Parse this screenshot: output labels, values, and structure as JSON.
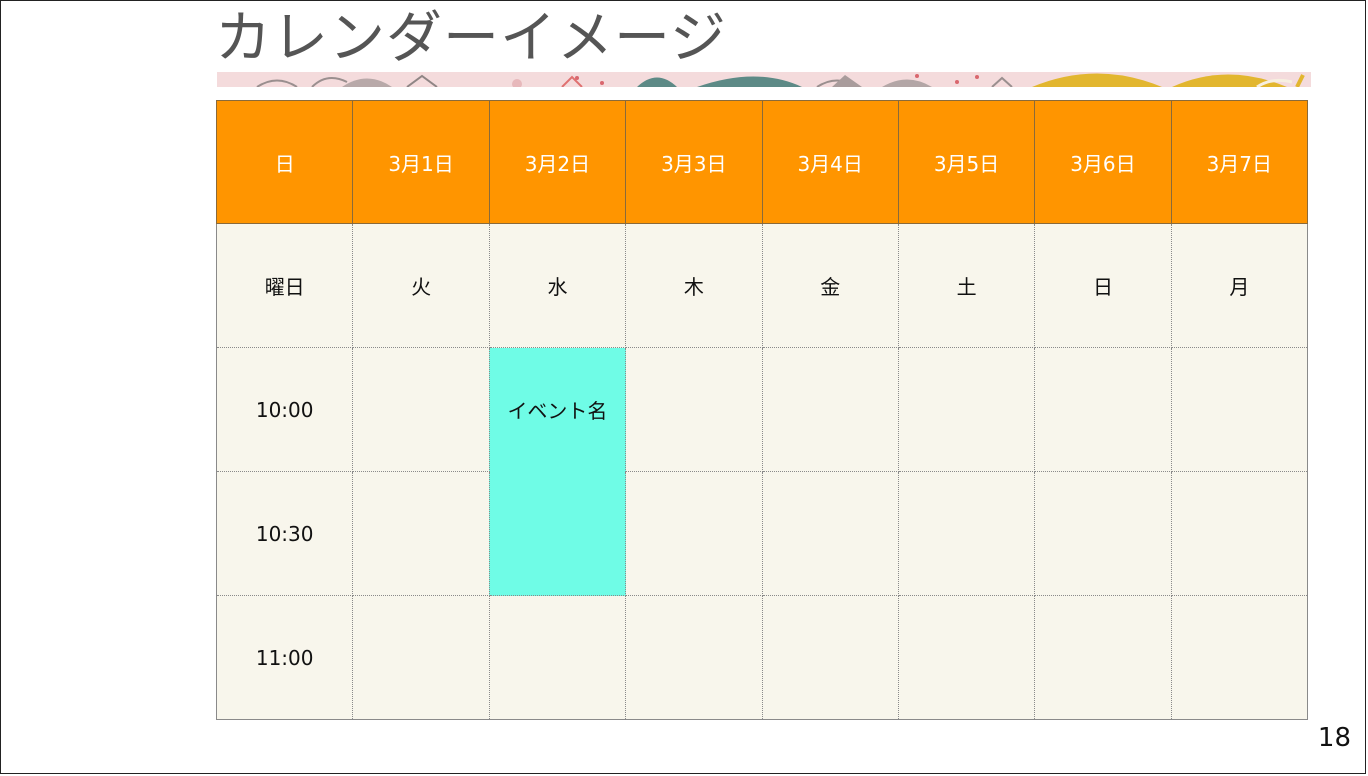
{
  "slide": {
    "title": "カレンダーイメージ",
    "page_number": "18"
  },
  "calendar": {
    "header": [
      "日",
      "3月1日",
      "3月2日",
      "3月3日",
      "3月4日",
      "3月5日",
      "3月6日",
      "3月7日"
    ],
    "weekday_row": [
      "曜日",
      "火",
      "水",
      "木",
      "金",
      "土",
      "日",
      "月"
    ],
    "times": [
      "10:00",
      "10:30",
      "11:00"
    ],
    "event": {
      "label": "イベント名",
      "color": "#6ffce6"
    },
    "header_color": "#ff9500",
    "cell_color": "#f8f6ec"
  }
}
